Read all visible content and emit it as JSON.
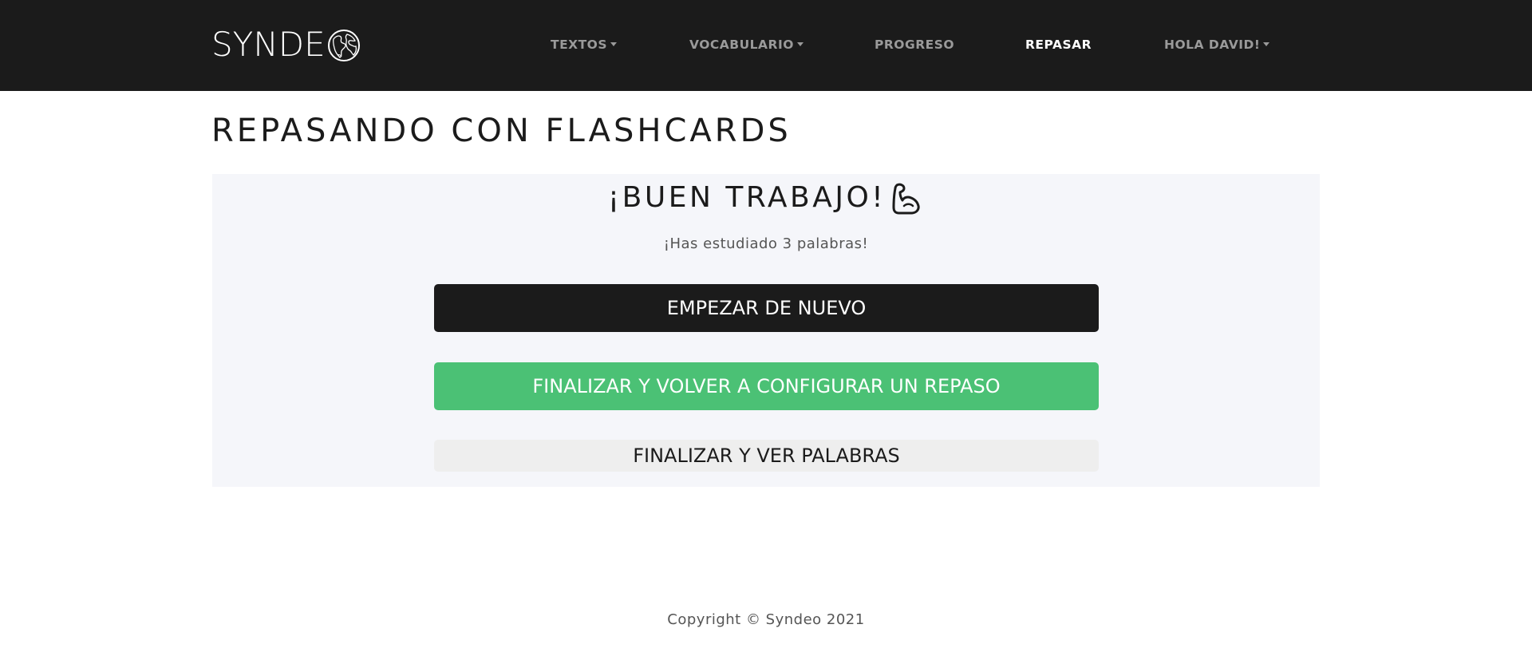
{
  "navbar": {
    "logo_text": "SYNDE",
    "logo_icon": "globe-icon",
    "items": [
      {
        "label": "TEXTOS",
        "dropdown": true
      },
      {
        "label": "VOCABULARIO",
        "dropdown": true
      },
      {
        "label": "PROGRESO",
        "dropdown": false
      },
      {
        "label": "REPASAR",
        "dropdown": false,
        "active": true
      },
      {
        "label": "HOLA DAVID!",
        "dropdown": true
      }
    ]
  },
  "page": {
    "title": "REPASANDO CON FLASHCARDS"
  },
  "result": {
    "heading": "¡BUEN TRABAJO!",
    "heading_icon": "flexed-biceps-icon",
    "message": "¡Has estudiado 3 palabras!"
  },
  "actions": {
    "restart_label": "EMPEZAR DE NUEVO",
    "finish_configure_label": "FINALIZAR Y VOLVER A CONFIGURAR UN REPASO",
    "finish_view_label": "FINALIZAR Y VER PALABRAS"
  },
  "footer": {
    "copyright": "Copyright © Syndeo 2021"
  },
  "colors": {
    "navbar_bg": "#1b1b1b",
    "nav_inactive": "#9a9a9a",
    "nav_active": "#ffffff",
    "panel_bg": "#f5f6fa",
    "primary_dark": "#1b1b1b",
    "success_green": "#4bc175",
    "light_button": "#eeeeee"
  }
}
